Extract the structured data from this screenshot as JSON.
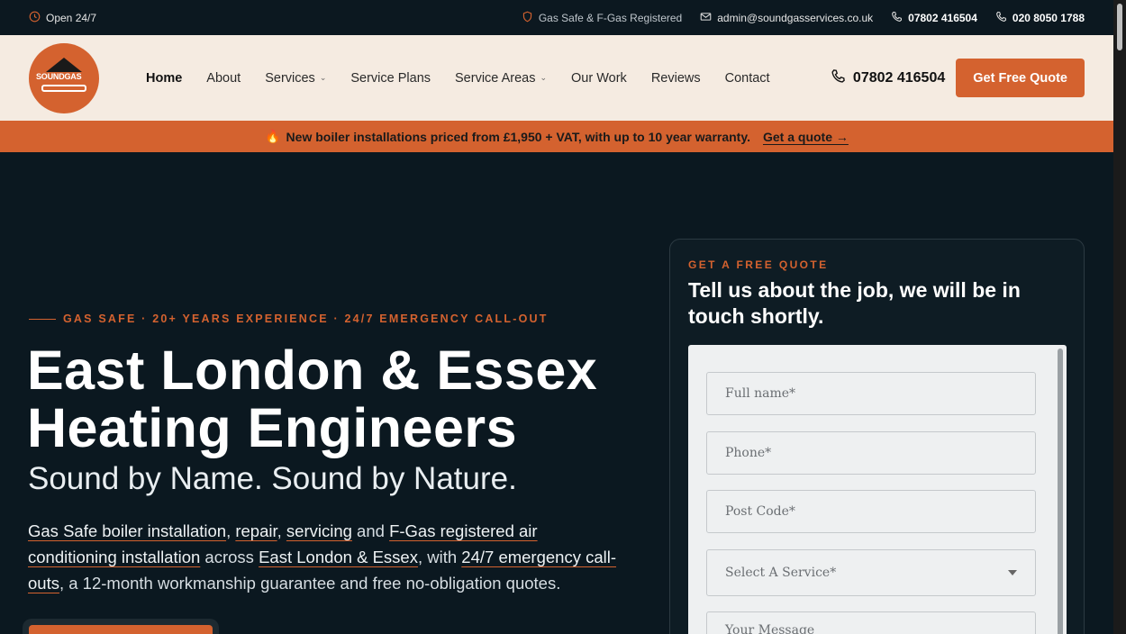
{
  "topbar": {
    "open_label": "Open 24/7",
    "registered": "Gas Safe & F-Gas Registered",
    "email": "admin@soundgasservices.co.uk",
    "phone_mobile": "07802 416504",
    "phone_landline": "020 8050 1788"
  },
  "logo": {
    "text": "SOUNDGAS"
  },
  "nav": {
    "items": [
      {
        "label": "Home",
        "active": true,
        "dropdown": false
      },
      {
        "label": "About",
        "active": false,
        "dropdown": false
      },
      {
        "label": "Services",
        "active": false,
        "dropdown": true
      },
      {
        "label": "Service Plans",
        "active": false,
        "dropdown": false
      },
      {
        "label": "Service Areas",
        "active": false,
        "dropdown": true
      },
      {
        "label": "Our Work",
        "active": false,
        "dropdown": false
      },
      {
        "label": "Reviews",
        "active": false,
        "dropdown": false
      },
      {
        "label": "Contact",
        "active": false,
        "dropdown": false
      }
    ],
    "phone": "07802 416504",
    "cta": "Get Free Quote"
  },
  "promo": {
    "icon": "🔥",
    "text": "New boiler installations priced from £1,950 + VAT, with up to 10 year warranty.",
    "link": "Get a quote →"
  },
  "hero": {
    "kicker": "GAS SAFE · 20+ YEARS EXPERIENCE · 24/7 EMERGENCY CALL-OUT",
    "title_line1": "East London & Essex",
    "title_line2": "Heating Engineers",
    "subtitle": "Sound by Name. Sound by Nature.",
    "lead": {
      "link1": "Gas Safe boiler installation",
      "sep1": ", ",
      "link2": "repair",
      "sep2": ", ",
      "link3": "servicing",
      "sep3": " and ",
      "link4": "F-Gas registered air conditioning installation",
      "sep4": " across ",
      "link5": "East London & Essex",
      "sep5": ", with ",
      "link6": "24/7 emergency call-outs",
      "tail": ", a 12-month workmanship guarantee and free no-obligation quotes."
    }
  },
  "quote_card": {
    "kicker": "GET A FREE QUOTE",
    "title": "Tell us about the job, we will be in touch shortly.",
    "fields": {
      "full_name": "Full name*",
      "phone": "Phone*",
      "post_code": "Post Code*",
      "service": "Select A Service*",
      "message": "Your Message"
    }
  },
  "colors": {
    "accent": "#d4622f",
    "dark_bg": "#0b1820",
    "nav_bg": "#f5ebe1"
  }
}
